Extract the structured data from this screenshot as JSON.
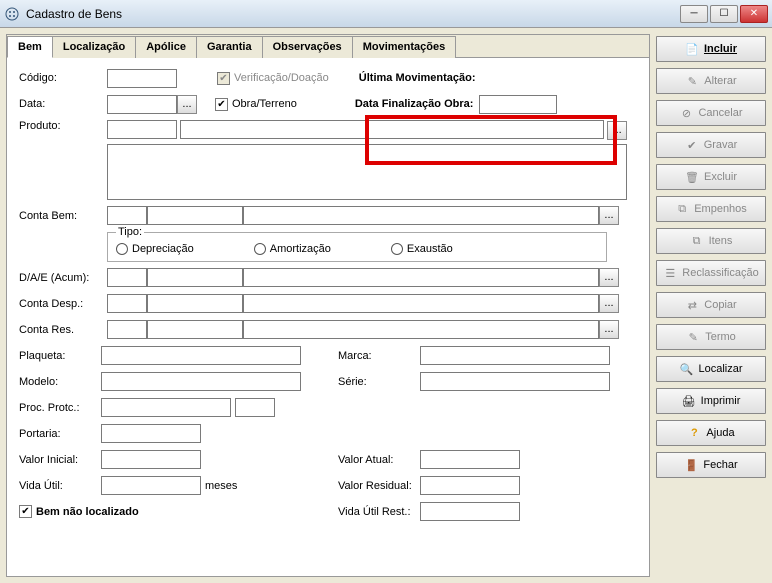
{
  "window": {
    "title": "Cadastro de Bens"
  },
  "tabs": [
    "Bem",
    "Localização",
    "Apólice",
    "Garantia",
    "Observações",
    "Movimentações"
  ],
  "labels": {
    "codigo": "Código:",
    "data": "Data:",
    "produto": "Produto:",
    "verif": "Verificação/Doação",
    "obra": "Obra/Terreno",
    "ultmov": "Última Movimentação:",
    "datafinal": "Data Finalização Obra:",
    "contabem": "Conta Bem:",
    "tipo": "Tipo:",
    "deprec": "Depreciação",
    "amort": "Amortização",
    "exaust": "Exaustão",
    "dae": "D/A/E (Acum):",
    "contadesp": "Conta Desp.:",
    "contares": "Conta Res.",
    "plaqueta": "Plaqueta:",
    "modelo": "Modelo:",
    "marca": "Marca:",
    "serie": "Série:",
    "procprotc": "Proc. Protc.:",
    "portaria": "Portaria:",
    "valorini": "Valor Inicial:",
    "valoratual": "Valor Atual:",
    "vidautil": "Vida Útil:",
    "meses": "meses",
    "valorresid": "Valor Residual:",
    "bemnao": "Bem não localizado",
    "vidarest": "Vida Útil Rest.:"
  },
  "buttons": {
    "incluir": "Incluir",
    "alterar": "Alterar",
    "cancelar": "Cancelar",
    "gravar": "Gravar",
    "excluir": "Excluir",
    "empenhos": "Empenhos",
    "itens": "Itens",
    "reclass": "Reclassificação",
    "copiar": "Copiar",
    "termo": "Termo",
    "localizar": "Localizar",
    "imprimir": "Imprimir",
    "ajuda": "Ajuda",
    "fechar": "Fechar"
  },
  "masks": {
    "dash": "__.__.__.__"
  }
}
